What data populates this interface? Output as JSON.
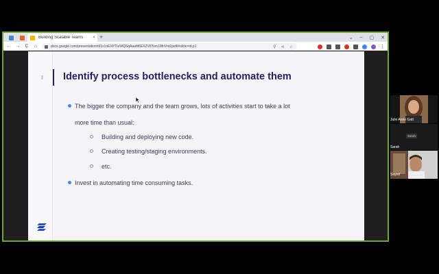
{
  "browser": {
    "active_tab_title": "Building Scalable Teams",
    "tab_close": "×",
    "new_tab": "+",
    "window_controls": [
      "⌄",
      "–",
      "▢",
      "✕"
    ],
    "nav": [
      "←",
      "→",
      "C",
      "⌂"
    ],
    "url": "docs.google.com/presentation/d/1x1nEXPTIeWQSqAaaM6EXZV8Tom18fnVnt1jedIt#slide=id.p1",
    "omnibox_icons": [
      "⚲",
      "⋖",
      "☆"
    ],
    "menu": "⋮"
  },
  "slide": {
    "title": "Identify process bottlenecks and automate them",
    "bullet1_line1": "The bigger the company and the team grows, lots of activities start to take a lot",
    "bullet1_line2": "more time than usual:",
    "sub1": "Building and deploying new code.",
    "sub2": "Creating testing/staging environments.",
    "sub3": "etc.",
    "bullet2": "Invest in automating time consuming tasks."
  },
  "participants": {
    "p1_name": "Julie Anne Gatt",
    "p2_name": "Sarah",
    "p2_label": "Sarah",
    "p3_name": "Sayed"
  },
  "colors": {
    "share_border": "#6fa832",
    "title": "#23215f",
    "bullet": "#4a86e8"
  }
}
